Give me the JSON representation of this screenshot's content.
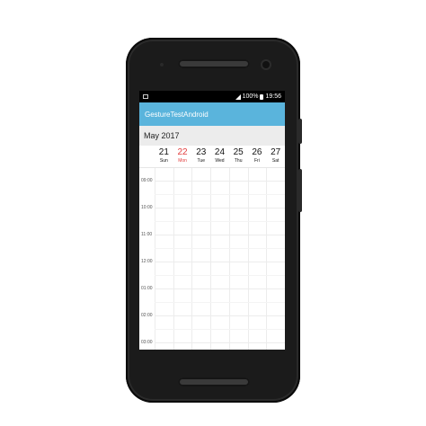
{
  "status_bar": {
    "battery": "100%",
    "time": "19:56"
  },
  "app": {
    "title": "GestureTestAndroid"
  },
  "calendar": {
    "month_label": "May 2017",
    "days": [
      {
        "num": "21",
        "label": "Sun",
        "today": false
      },
      {
        "num": "22",
        "label": "Mon",
        "today": true
      },
      {
        "num": "23",
        "label": "Tue",
        "today": false
      },
      {
        "num": "24",
        "label": "Wed",
        "today": false
      },
      {
        "num": "25",
        "label": "Thu",
        "today": false
      },
      {
        "num": "26",
        "label": "Fri",
        "today": false
      },
      {
        "num": "27",
        "label": "Sat",
        "today": false
      }
    ],
    "times": [
      "09:00",
      "10:00",
      "11:00",
      "12:00",
      "01:00",
      "02:00",
      "03:00"
    ]
  },
  "colors": {
    "appbar": "#5ab4dc",
    "today": "#e23d3d",
    "phone": "#1b1b1b"
  },
  "icons": {
    "notification": "image-icon",
    "signal": "signal-icon",
    "battery": "battery-icon"
  }
}
